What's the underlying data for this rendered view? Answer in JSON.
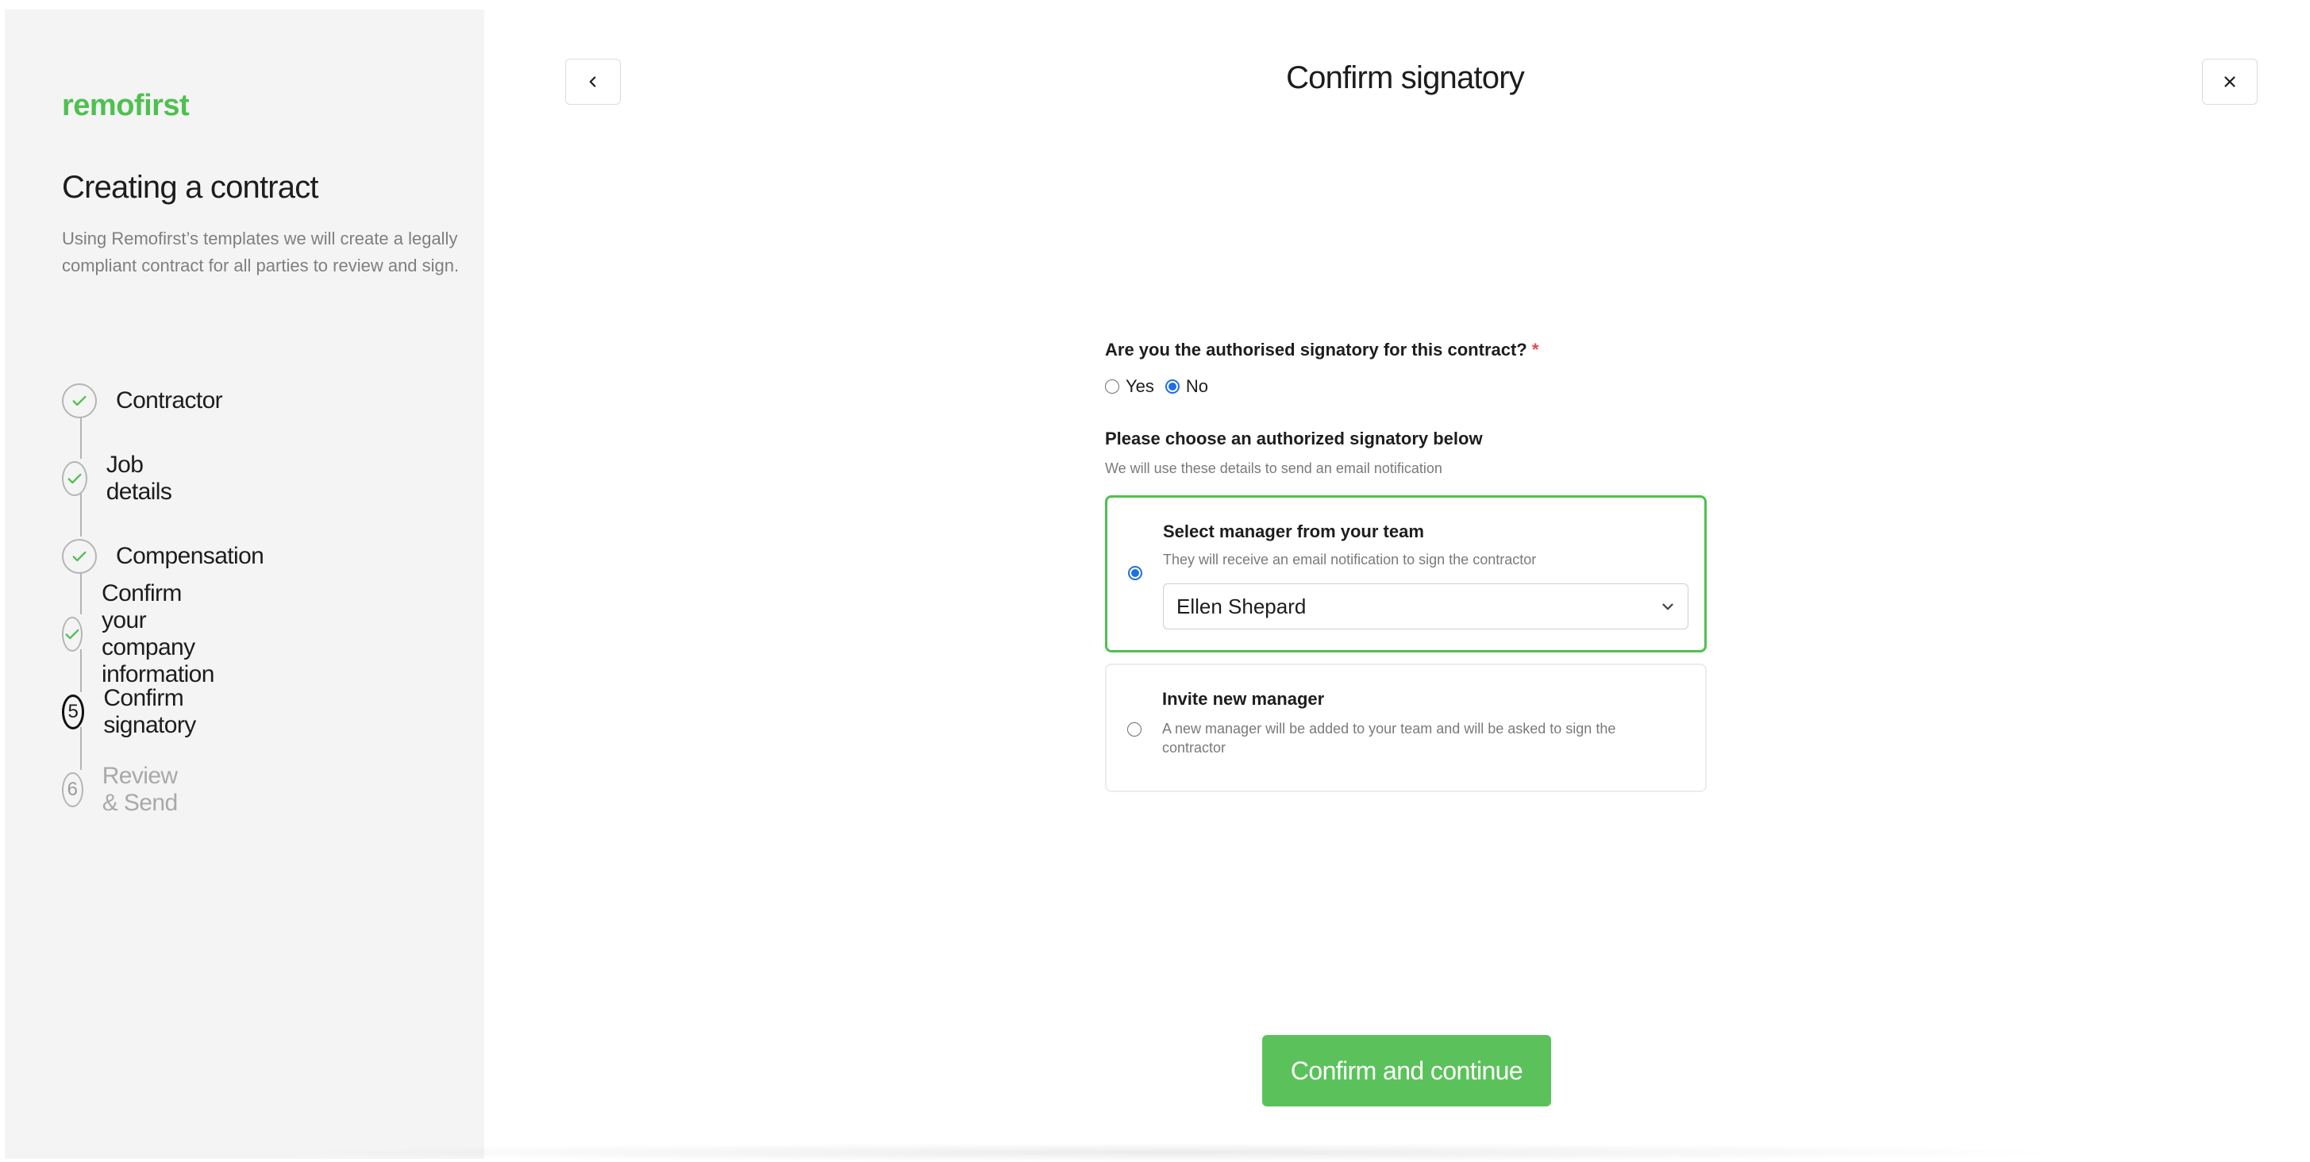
{
  "brand": {
    "logo_text": "remofirst",
    "accent": "#4fc050"
  },
  "sidebar": {
    "title": "Creating a contract",
    "description": "Using Remofirst’s templates we will create a legally compliant contract for all parties to review and sign.",
    "steps": [
      {
        "label": "Contractor",
        "status": "done",
        "icon": "check-icon"
      },
      {
        "label": "Job details",
        "status": "done",
        "icon": "check-icon"
      },
      {
        "label": "Compensation",
        "status": "done",
        "icon": "check-icon"
      },
      {
        "label": "Confirm your company information",
        "status": "done",
        "icon": "check-icon"
      },
      {
        "label": "Confirm signatory",
        "status": "active",
        "number": "5"
      },
      {
        "label": "Review & Send",
        "status": "pending",
        "number": "6"
      }
    ]
  },
  "header": {
    "title": "Confirm signatory",
    "back_icon": "chevron-left-icon",
    "close_icon": "close-icon"
  },
  "form": {
    "question": "Are you the authorised signatory for this contract?",
    "required_mark": "*",
    "options": [
      {
        "label": "Yes",
        "checked": false
      },
      {
        "label": "No",
        "checked": true
      }
    ],
    "section_label": "Please choose an authorized signatory below",
    "section_hint": "We will use these details to send an email notification",
    "cards": [
      {
        "title": "Select manager from your team",
        "description": "They will receive an email notification to sign the contractor",
        "selected": true,
        "select_value": "Ellen Shepard"
      },
      {
        "title": "Invite new manager",
        "description": "A new manager will be added to your team and will be asked to sign the contractor",
        "selected": false
      }
    ]
  },
  "footer": {
    "cta_label": "Confirm and continue"
  },
  "colors": {
    "primary_green": "#5bc25b",
    "radio_blue": "#1f6fe5",
    "required_red": "#e5484d"
  }
}
